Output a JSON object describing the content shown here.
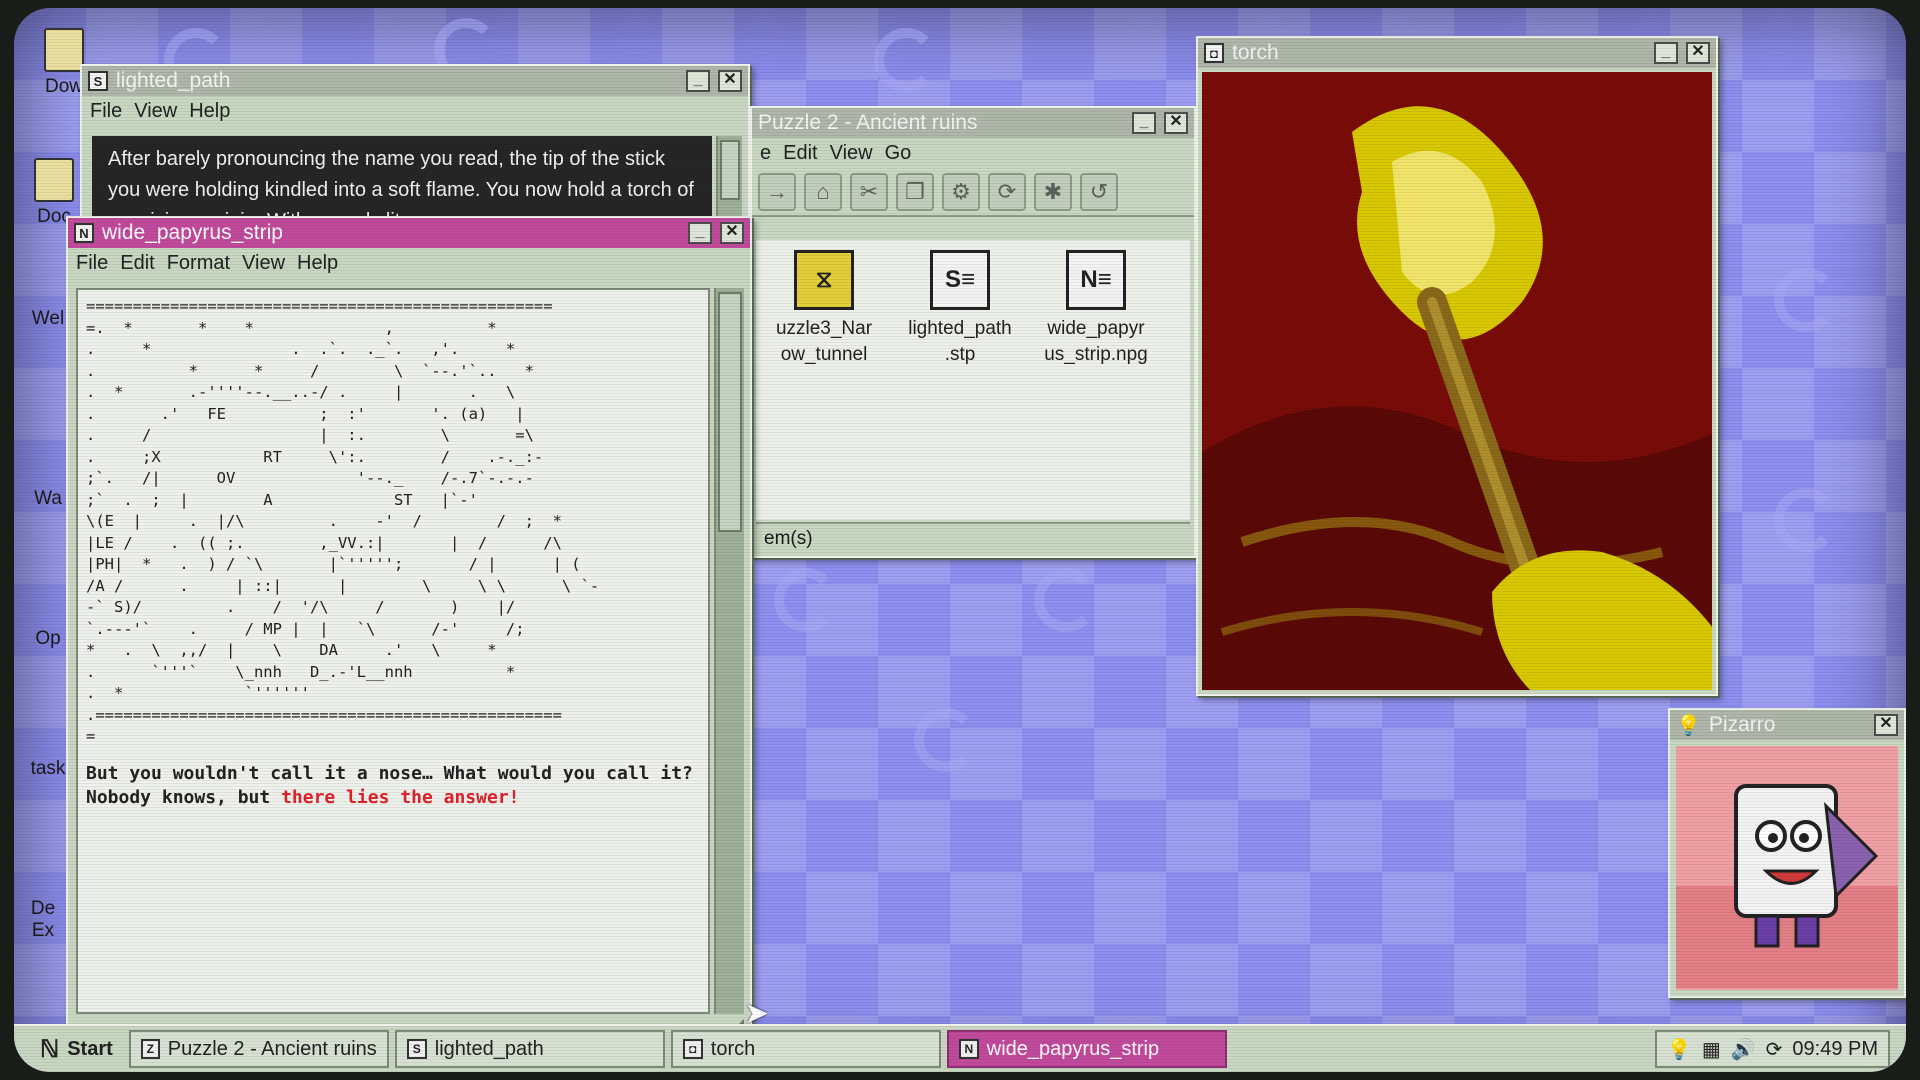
{
  "desktop": {
    "icons": [
      "Dow",
      "Doc",
      "Wel",
      "Wa",
      "Op",
      "task",
      "De Ex"
    ]
  },
  "lighted_path": {
    "title": "lighted_path",
    "menu": [
      "File",
      "View",
      "Help"
    ],
    "text": "After barely pronouncing the name you read, the tip of the stick you were holding kindled into a soft flame. You now hold a torch of suspicious origin. With a newly lit"
  },
  "papyrus": {
    "title": "wide_papyrus_strip",
    "menu": [
      "File",
      "Edit",
      "Format",
      "View",
      "Help"
    ],
    "art": "==================================================\n=.  *       *    *              ,          *\n.     *               .  .`.  ._`.   ,'.     *\n.          *      *     /        \\  `--.'`..   *\n.  *       .-''''--.__..-/ .     |       .   \\\n.       .'   FE          ;  :'       '. (a)   |\n.     /                  |  :.        \\       =\\\n.     ;X           RT     \\':.        /    .-._:-\n;`.   /|      OV             '--._    /-.7`-.-.-\n;`  .  ;  |        A             ST   |`-'\n\\(E  |     .  |/\\         .    -'  /        /  ;  *\n|LE /    .  (( ;.        ,_VV.:|       |  /      /\\\n|PH|  *   .  ) / `\\       |`''''';       / |      | (\n/A /      .     | ::|      |        \\     \\ \\      \\ `-\n-` S)/         .    /  '/\\     /       )    |/\n`.---'`    .     / MP |  |   `\\      /-'     /;\n*   .  \\  ,,/  |    \\    DA     .'   \\     *\n.      `'''`    \\_nnh   D_.-'L__nnh          *\n.  *             `''''''\n.==================================================\n=",
    "text_prefix": "But you wouldn't call it a nose… What would you call it? Nobody knows, but ",
    "text_highlight": "there lies the answer!"
  },
  "explorer": {
    "title": "Puzzle 2 - Ancient ruins",
    "menu": [
      "e",
      "Edit",
      "View",
      "Go"
    ],
    "files": [
      {
        "name": "uzzle3_Nar\now_tunnel",
        "icon": "zipper-folder-icon"
      },
      {
        "name": "lighted_path\n.stp",
        "icon": "script-document-icon"
      },
      {
        "name": "wide_papyr\nus_strip.npg",
        "icon": "notepad-document-icon"
      }
    ],
    "status": "em(s)"
  },
  "torch": {
    "title": "torch"
  },
  "pizarro": {
    "title": "Pizarro"
  },
  "taskbar": {
    "start": "Start",
    "tasks": [
      "Puzzle 2 - Ancient ruins",
      "lighted_path",
      "torch",
      "wide_papyrus_strip"
    ],
    "clock": "09:49 PM"
  },
  "colors": {
    "accent": "#c24a9c",
    "window": "#c9d8c2",
    "desktop": "#8e8ff0",
    "torch_bg": "#7a0c08",
    "torch_flame": "#d8c800"
  }
}
